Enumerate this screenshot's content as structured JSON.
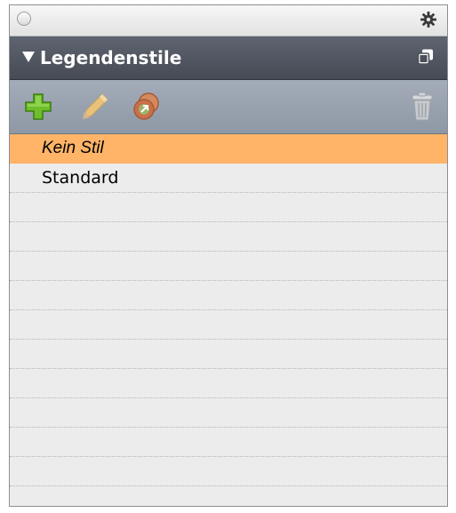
{
  "panel": {
    "header": {
      "title": "Legendenstile"
    },
    "toolbar": {
      "buttons": [
        {
          "name": "add",
          "icon": "plus-icon",
          "color": "#6cbf2a"
        },
        {
          "name": "edit",
          "icon": "pencil-icon",
          "color": "#e9c27a"
        },
        {
          "name": "duplicate",
          "icon": "duplicate-icon",
          "color": "#c9704a"
        },
        {
          "name": "delete",
          "icon": "trash-icon",
          "color": "#c7cbd0"
        }
      ]
    },
    "styles": [
      {
        "label": "Kein Stil",
        "selected": true
      },
      {
        "label": "Standard",
        "selected": false
      }
    ],
    "empty_rows": 11
  },
  "colors": {
    "header_bg": "#4f5560",
    "toolbar_bg": "#98a1ad",
    "selection": "#ffb468",
    "list_bg": "#ececec"
  }
}
